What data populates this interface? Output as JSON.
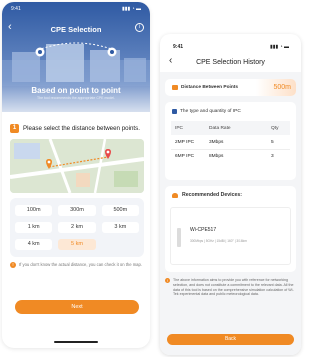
{
  "screen1": {
    "status_time": "9:41",
    "title": "CPE Selection",
    "hero_heading": "Based on point to point",
    "hero_sub": "The tool recommends the appropriate CPE model.",
    "section_number": "1",
    "section_title": "Please select the distance between points.",
    "distances": [
      "100m",
      "300m",
      "500m",
      "1 km",
      "2 km",
      "3 km",
      "4 km",
      "5 km"
    ],
    "selected_distance": "5 km",
    "note": "If you don't know the actual distance, you can check it on the map.",
    "next_label": "Next",
    "colors": {
      "accent": "#f08a24",
      "hero": "#2f5aa3"
    }
  },
  "screen2": {
    "status_time": "9:41",
    "title": "CPE Selection History",
    "distance_label": "Distance Between Points",
    "distance_value": "500m",
    "ipc_section": "The type and quantity of IPC",
    "table_headers": [
      "IPC",
      "Data Rate",
      "Qty"
    ],
    "table_rows": [
      [
        "2MP IPC",
        "3Mbps",
        "5"
      ],
      [
        "6MP IPC",
        "8Mbps",
        "3"
      ]
    ],
    "recommended_label": "Recommended Devices:",
    "device_name": "Wi-CPE517",
    "device_specs": "300Mbps | 5GHz | 15dBi | 160° | 3/16km",
    "disclaimer": "The above information aims to provide you with reference for networking selection, and does not constitute a commitment to the relevant data. All the data of this tool is based on the comprehensive simulation calculation of Wi-Tek experimental data and public meteorological data.",
    "back_label": "Back"
  }
}
